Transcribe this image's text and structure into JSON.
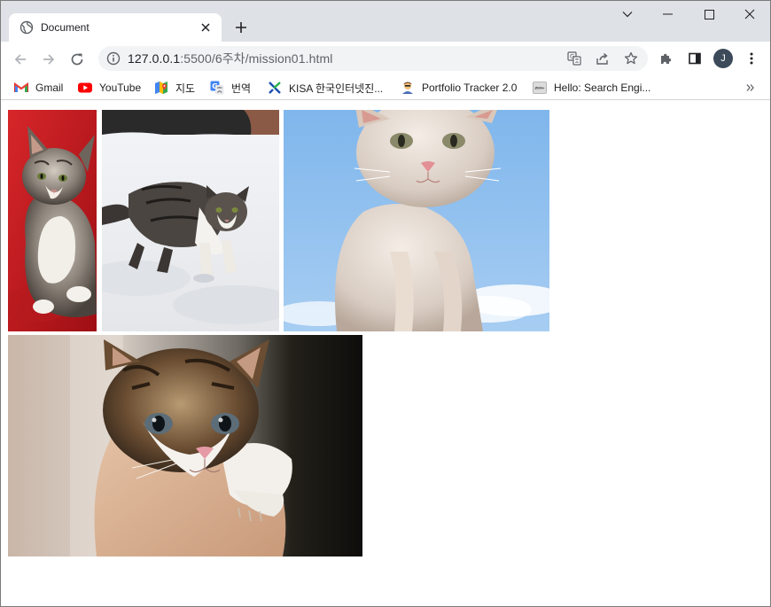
{
  "tab": {
    "title": "Document"
  },
  "address": {
    "host": "127.0.0.1",
    "rest": ":5500/6주차/mission01.html"
  },
  "profile": {
    "initial": "J"
  },
  "bookmarks": [
    {
      "label": "Gmail",
      "icon": "gmail-icon"
    },
    {
      "label": "YouTube",
      "icon": "youtube-icon"
    },
    {
      "label": "지도",
      "icon": "maps-icon"
    },
    {
      "label": "번역",
      "icon": "translate-icon"
    },
    {
      "label": "KISA 한국인터넷진...",
      "icon": "kisa-icon"
    },
    {
      "label": "Portfolio Tracker 2.0",
      "icon": "portfolio-icon"
    },
    {
      "label": "Hello: Search Engi...",
      "icon": "hello-icon"
    }
  ],
  "colors": {
    "tabstrip": "#dee1e6",
    "omnibox": "#f1f3f4",
    "accent": "#1a73e8"
  }
}
